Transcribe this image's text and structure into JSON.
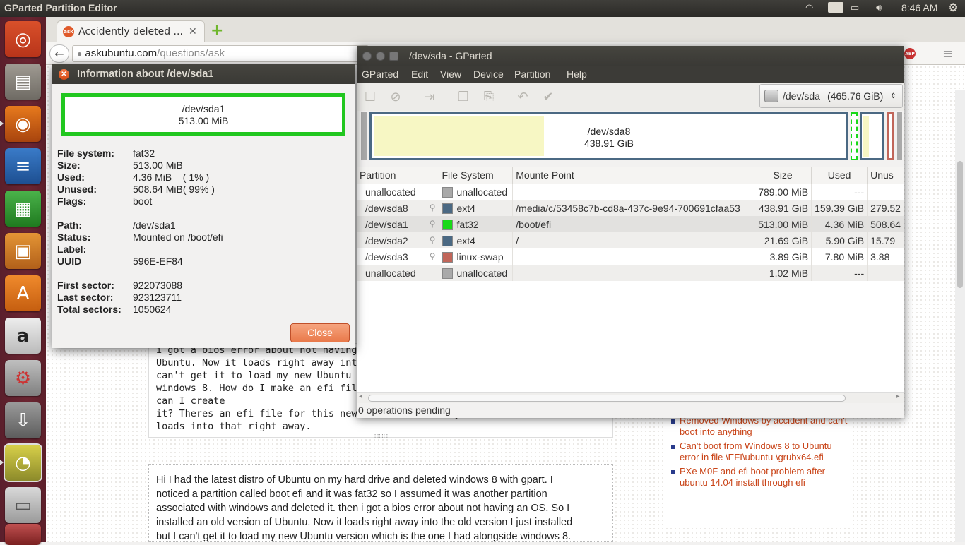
{
  "top_panel": {
    "app_title": "GParted Partition Editor",
    "keyboard": "En",
    "clock": "8:46 AM"
  },
  "launcher": {
    "items": [
      "ubuntu-dash",
      "files",
      "firefox",
      "writer",
      "calc",
      "impress",
      "software-center",
      "amazon",
      "system-settings",
      "update-manager",
      "gparted",
      "drive"
    ]
  },
  "browser": {
    "tab_title": "Accidently deleted ...",
    "url_host": "askubuntu.com",
    "url_path": "/questions/ask",
    "tab_logo": "ask",
    "abp": "ABP"
  },
  "question_code": {
    "lines": [
      "i got a bios error about not having an OS. So I installed an old version of",
      "Ubuntu. Now it loads right away into the old version I just installed but I",
      "can't get it to load my new Ubuntu version which is the one I had alongside",
      "windows 8. How do I make an efi file? Does my version of Ubuntu have one or can I create",
      "it? Theres an efi file for this new Ubuntu but it says fat32 error and it",
      "loads into that right away."
    ]
  },
  "question_preview": {
    "lines": [
      "Hi I had the latest distro of Ubuntu on my hard drive and deleted windows 8 with gpart. I",
      "noticed a partition called boot efi and it was fat32 so I assumed it was another partition",
      "associated with windows and deleted it. then i got a bios error about not having an OS. So I",
      "installed an old version of Ubuntu. Now it loads right away into the old version I just installed",
      "but I can't get it to load my new Ubuntu version which is the one I had alongside windows 8."
    ]
  },
  "related": {
    "items": [
      "Removed Windows by accident and can't boot into anything",
      "Can't boot from Windows 8 to Ubuntu error in file \\EFI\\ubuntu \\grubx64.efi",
      "PXe M0F and efi boot problem after ubuntu 14.04 install through efi"
    ]
  },
  "gparted": {
    "title": "/dev/sda - GParted",
    "menu": [
      "GParted",
      "Edit",
      "View",
      "Device",
      "Partition",
      "Help"
    ],
    "device": "/dev/sda",
    "device_size": "(465.76 GiB)",
    "diskmap_label": "/dev/sda8",
    "diskmap_size": "438.91 GiB",
    "columns": [
      "Partition",
      "File System",
      "Mounte Point",
      "Size",
      "Used",
      "Unus"
    ],
    "rows": [
      {
        "partition": "unallocated",
        "fs": "unallocated",
        "color": "#a9a9a9",
        "mount": "",
        "size": "789.00 MiB",
        "used": "---",
        "unused": "",
        "key": false
      },
      {
        "partition": "/dev/sda8",
        "fs": "ext4",
        "color": "#4b6983",
        "mount": "/media/c/53458c7b-cd8a-437c-9e94-700691cfaa53",
        "size": "438.91 GiB",
        "used": "159.39 GiB",
        "unused": "279.52",
        "key": true
      },
      {
        "partition": "/dev/sda1",
        "fs": "fat32",
        "color": "#18d918",
        "mount": "/boot/efi",
        "size": "513.00 MiB",
        "used": "4.36 MiB",
        "unused": "508.64",
        "key": true
      },
      {
        "partition": "/dev/sda2",
        "fs": "ext4",
        "color": "#4b6983",
        "mount": "/",
        "size": "21.69 GiB",
        "used": "5.90 GiB",
        "unused": "15.79",
        "key": true
      },
      {
        "partition": "/dev/sda3",
        "fs": "linux-swap",
        "color": "#c1665a",
        "mount": "",
        "size": "3.89 GiB",
        "used": "7.80 MiB",
        "unused": "3.88",
        "key": true
      },
      {
        "partition": "unallocated",
        "fs": "unallocated",
        "color": "#a9a9a9",
        "mount": "",
        "size": "1.02 MiB",
        "used": "---",
        "unused": "",
        "key": false
      }
    ],
    "status": "0 operations pending"
  },
  "dialog": {
    "title": "Information about /dev/sda1",
    "bar_name": "/dev/sda1",
    "bar_size": "513.00 MiB",
    "fields": {
      "file_system_label": "File system:",
      "file_system": "fat32",
      "size_label": "Size:",
      "size": "513.00 MiB",
      "used_label": "Used:",
      "used": "4.36 MiB    ( 1% )",
      "unused_label": "Unused:",
      "unused": "508.64 MiB( 99% )",
      "flags_label": "Flags:",
      "flags": "boot",
      "path_label": "Path:",
      "path": "/dev/sda1",
      "status_label": "Status:",
      "status": "Mounted on /boot/efi",
      "label_label": "Label:",
      "label": "",
      "uuid_label": "UUID",
      "uuid": "596E-EF84",
      "first_label": "First sector:",
      "first": "922073088",
      "last_label": "Last sector:",
      "last": "923123711",
      "total_label": "Total sectors:",
      "total": "1050624"
    },
    "close": "Close"
  }
}
